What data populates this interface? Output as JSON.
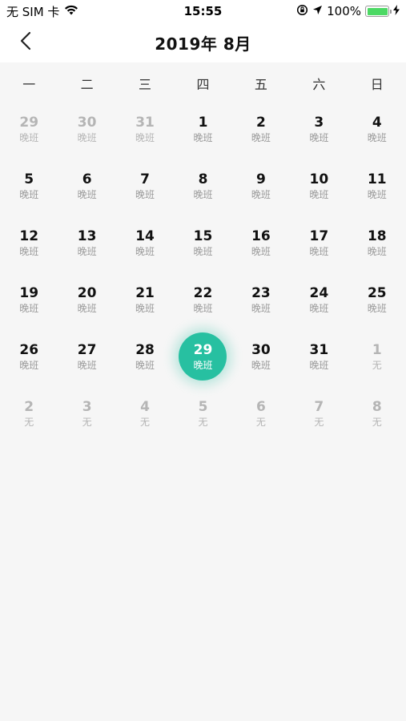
{
  "status_bar": {
    "carrier": "无 SIM 卡",
    "time": "15:55",
    "battery": "100%",
    "battery_level": 1.0
  },
  "nav": {
    "title": "2019年 8月"
  },
  "weekdays": [
    "一",
    "二",
    "三",
    "四",
    "五",
    "六",
    "日"
  ],
  "calendar": {
    "selected_day": "29",
    "accent_color": "#27c0a1",
    "days": [
      {
        "num": "29",
        "shift": "晚班",
        "current_month": false
      },
      {
        "num": "30",
        "shift": "晚班",
        "current_month": false
      },
      {
        "num": "31",
        "shift": "晚班",
        "current_month": false
      },
      {
        "num": "1",
        "shift": "晚班",
        "current_month": true
      },
      {
        "num": "2",
        "shift": "晚班",
        "current_month": true
      },
      {
        "num": "3",
        "shift": "晚班",
        "current_month": true
      },
      {
        "num": "4",
        "shift": "晚班",
        "current_month": true
      },
      {
        "num": "5",
        "shift": "晚班",
        "current_month": true
      },
      {
        "num": "6",
        "shift": "晚班",
        "current_month": true
      },
      {
        "num": "7",
        "shift": "晚班",
        "current_month": true
      },
      {
        "num": "8",
        "shift": "晚班",
        "current_month": true
      },
      {
        "num": "9",
        "shift": "晚班",
        "current_month": true
      },
      {
        "num": "10",
        "shift": "晚班",
        "current_month": true
      },
      {
        "num": "11",
        "shift": "晚班",
        "current_month": true
      },
      {
        "num": "12",
        "shift": "晚班",
        "current_month": true
      },
      {
        "num": "13",
        "shift": "晚班",
        "current_month": true
      },
      {
        "num": "14",
        "shift": "晚班",
        "current_month": true
      },
      {
        "num": "15",
        "shift": "晚班",
        "current_month": true
      },
      {
        "num": "16",
        "shift": "晚班",
        "current_month": true
      },
      {
        "num": "17",
        "shift": "晚班",
        "current_month": true
      },
      {
        "num": "18",
        "shift": "晚班",
        "current_month": true
      },
      {
        "num": "19",
        "shift": "晚班",
        "current_month": true
      },
      {
        "num": "20",
        "shift": "晚班",
        "current_month": true
      },
      {
        "num": "21",
        "shift": "晚班",
        "current_month": true
      },
      {
        "num": "22",
        "shift": "晚班",
        "current_month": true
      },
      {
        "num": "23",
        "shift": "晚班",
        "current_month": true
      },
      {
        "num": "24",
        "shift": "晚班",
        "current_month": true
      },
      {
        "num": "25",
        "shift": "晚班",
        "current_month": true
      },
      {
        "num": "26",
        "shift": "晚班",
        "current_month": true
      },
      {
        "num": "27",
        "shift": "晚班",
        "current_month": true
      },
      {
        "num": "28",
        "shift": "晚班",
        "current_month": true
      },
      {
        "num": "29",
        "shift": "晚班",
        "current_month": true,
        "selected": true
      },
      {
        "num": "30",
        "shift": "晚班",
        "current_month": true
      },
      {
        "num": "31",
        "shift": "晚班",
        "current_month": true
      },
      {
        "num": "1",
        "shift": "无",
        "current_month": false
      },
      {
        "num": "2",
        "shift": "无",
        "current_month": false
      },
      {
        "num": "3",
        "shift": "无",
        "current_month": false
      },
      {
        "num": "4",
        "shift": "无",
        "current_month": false
      },
      {
        "num": "5",
        "shift": "无",
        "current_month": false
      },
      {
        "num": "6",
        "shift": "无",
        "current_month": false
      },
      {
        "num": "7",
        "shift": "无",
        "current_month": false
      },
      {
        "num": "8",
        "shift": "无",
        "current_month": false
      }
    ]
  }
}
